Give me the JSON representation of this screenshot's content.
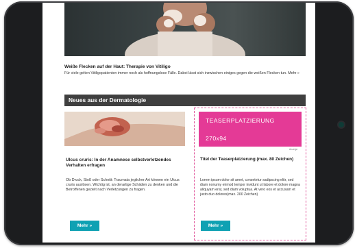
{
  "hero": {
    "title": "Weiße Flecken auf der Haut: Therapie von Vitiligo",
    "text": "Für viele gelten Vitiligopatienten immer noch als hoffnungslose Fälle. Dabei lässt sich inzwischen einiges gegen die weißen Flecken tun. Mehr »"
  },
  "section": {
    "title": "Neues aus der Dermatologie"
  },
  "article": {
    "title": "Ulcus cruris: In der Anamnese selbstverletzendes Verhalten erfragen",
    "text": "Ob Druck, Stoß oder Schnitt: Traumata jeglicher Art können ein Ulcus cruris auslösen. Wichtig ist, an derartige Schäden zu denken und die Betroffenen gezielt nach Verletzungen zu fragen.",
    "button": "Mehr »"
  },
  "teaser": {
    "banner_line1": "TEASERPLATZIERUNG",
    "banner_line2": "270x94",
    "anzeige": "Anzeige",
    "title": "Titel der Teaserplatzierung (max. 80 Zeichen)",
    "text": "Lorem ipsum dolor sit amet, consetetur sadipscing elitr, sed diam nonumy eirmod tempor invidunt ut labore et dolore magna aliquyam erat, sed diam voluptua. At vero eos et accusam et justo duo dolores(max. 200 Zeichen)",
    "button": "Mehr »"
  },
  "colors": {
    "accent_button": "#0fa1b3",
    "teaser_pink": "#e43a96",
    "section_bar": "#3f3f3f",
    "frame": "#1c1d1f"
  }
}
